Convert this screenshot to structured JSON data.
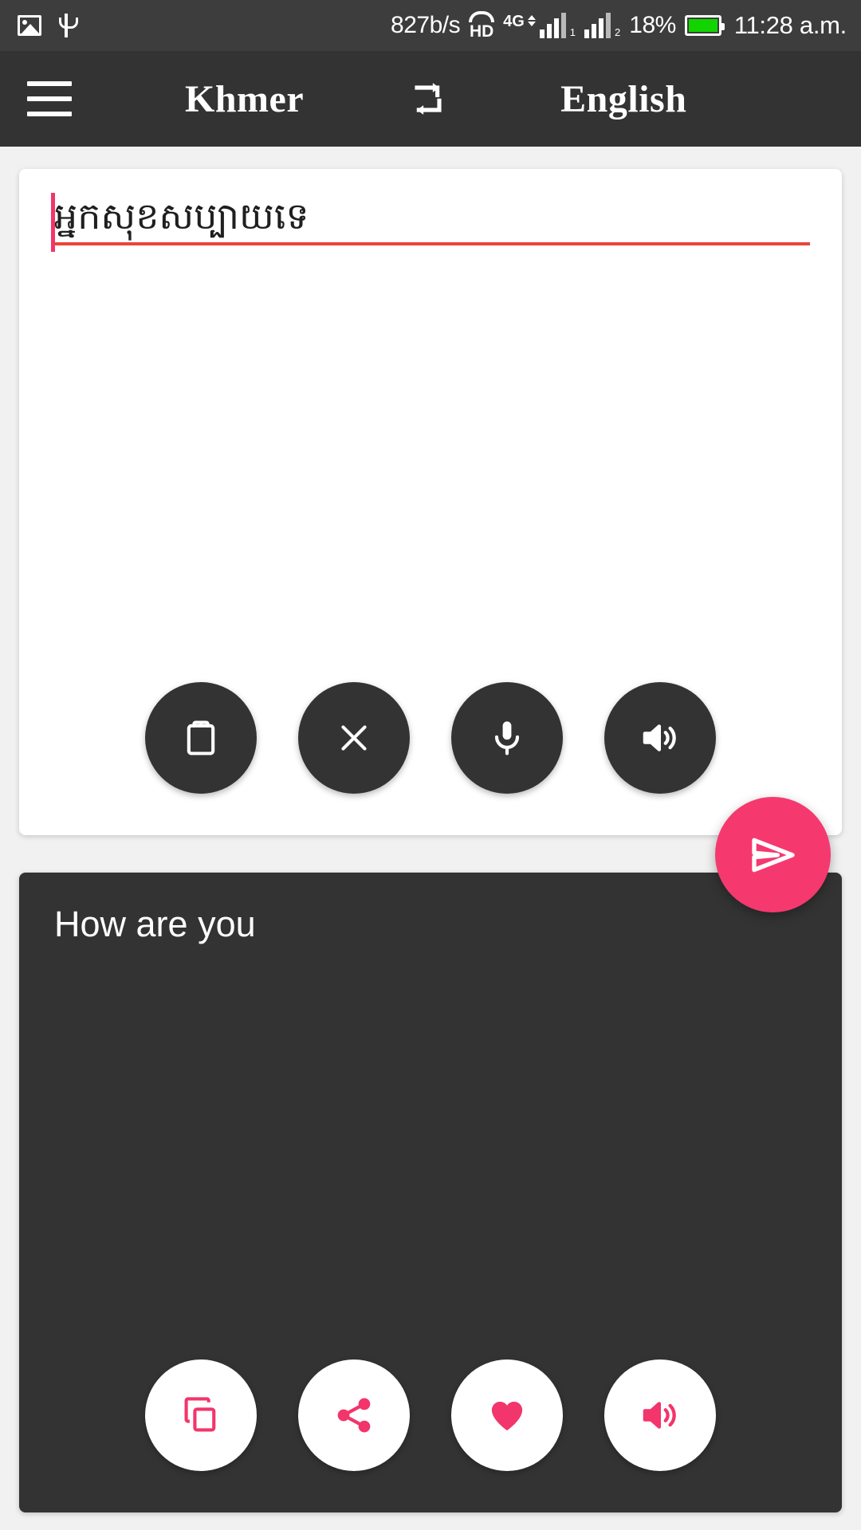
{
  "status_bar": {
    "left_icons": [
      "image-icon",
      "usb-icon"
    ],
    "network_speed": "827b/s",
    "hd_label": "HD",
    "network_type": "4G",
    "sim1_label": "1",
    "sim2_label": "2",
    "battery_percent": "18%",
    "battery_color": "#12d500",
    "time": "11:28 a.m."
  },
  "header": {
    "menu_icon": "hamburger-menu-icon",
    "source_language": "Khmer",
    "swap_icon": "swap-languages-icon",
    "target_language": "English",
    "background_color": "#333333"
  },
  "input_panel": {
    "text": "អ្នកសុខសប្បាយទេ",
    "caret_color": "#f2356b",
    "spellcheck_underline_color": "#e8453c",
    "actions": [
      {
        "name": "paste-button",
        "icon": "clipboard-icon",
        "label": "Paste"
      },
      {
        "name": "clear-button",
        "icon": "close-icon",
        "label": "Clear"
      },
      {
        "name": "voice-input-button",
        "icon": "microphone-icon",
        "label": "Voice input"
      },
      {
        "name": "speak-source-button",
        "icon": "speaker-icon",
        "label": "Listen"
      }
    ]
  },
  "send_button": {
    "icon": "send-icon",
    "label": "Translate",
    "color": "#f5396f"
  },
  "output_panel": {
    "text": "How are you",
    "background_color": "#333333",
    "actions": [
      {
        "name": "copy-button",
        "icon": "copy-icon",
        "label": "Copy"
      },
      {
        "name": "share-button",
        "icon": "share-icon",
        "label": "Share"
      },
      {
        "name": "favorite-button",
        "icon": "heart-icon",
        "label": "Favorite"
      },
      {
        "name": "speak-result-button",
        "icon": "speaker-icon",
        "label": "Listen"
      }
    ],
    "action_color": "#f2356b"
  }
}
